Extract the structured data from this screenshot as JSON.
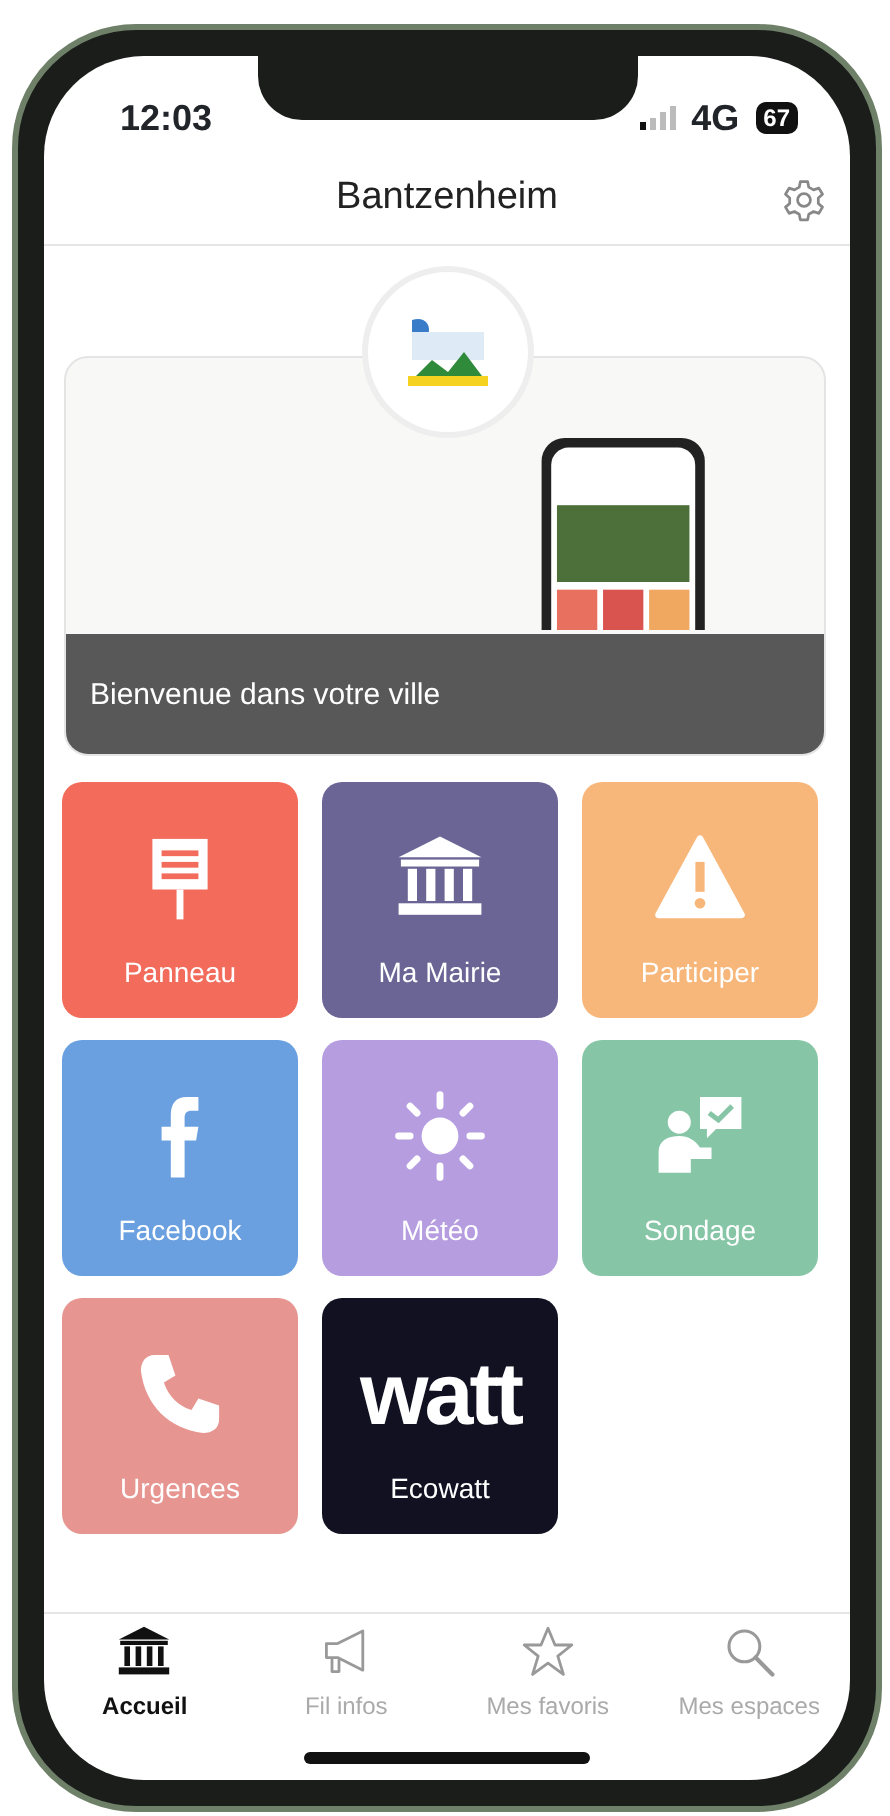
{
  "status_bar": {
    "time": "12:03",
    "network": "4G",
    "battery": "67"
  },
  "header": {
    "title": "Bantzenheim"
  },
  "banner": {
    "caption": "Bienvenue dans votre ville"
  },
  "tiles": [
    {
      "label": "Panneau",
      "kind": "sign",
      "color": "#f26b5b"
    },
    {
      "label": "Ma Mairie",
      "kind": "townhall",
      "color": "#6b6596"
    },
    {
      "label": "Participer",
      "kind": "warning",
      "color": "#f8b77a"
    },
    {
      "label": "Facebook",
      "kind": "facebook",
      "color": "#6a9fe0"
    },
    {
      "label": "Météo",
      "kind": "sun",
      "color": "#b59de0"
    },
    {
      "label": "Sondage",
      "kind": "poll",
      "color": "#86c5a6"
    },
    {
      "label": "Urgences",
      "kind": "phone",
      "color": "#e79590"
    },
    {
      "label": "Ecowatt",
      "kind": "logo",
      "logo_text": "watt",
      "color": "#111122"
    }
  ],
  "tab_bar": [
    {
      "label": "Accueil",
      "kind": "townhall",
      "selected": true
    },
    {
      "label": "Fil infos",
      "kind": "megaphone",
      "selected": false
    },
    {
      "label": "Mes favoris",
      "kind": "star",
      "selected": false
    },
    {
      "label": "Mes espaces",
      "kind": "search",
      "selected": false
    }
  ]
}
